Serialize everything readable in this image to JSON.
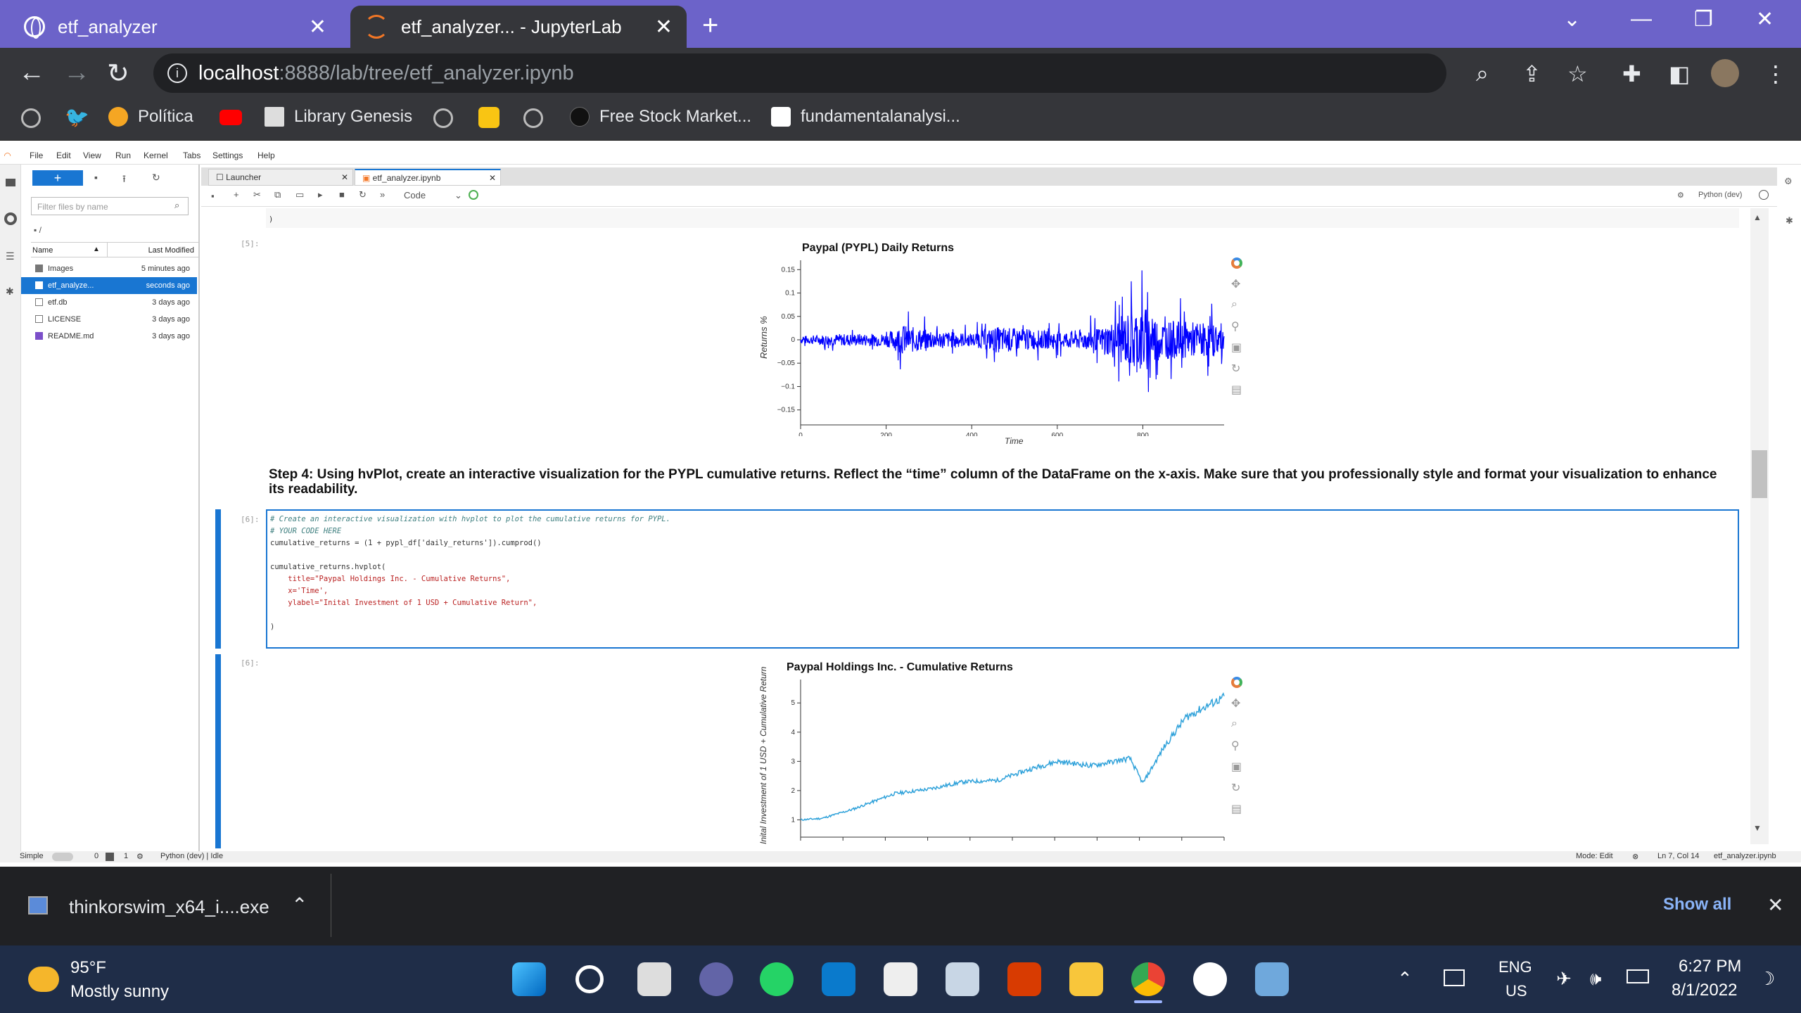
{
  "browser": {
    "tabs": [
      {
        "title": "etf_analyzer",
        "active": false
      },
      {
        "title": "etf_analyzer... - JupyterLab",
        "active": true
      }
    ],
    "url_host": "localhost",
    "url_path": ":8888/lab/tree/etf_analyzer.ipynb",
    "bookmarks": [
      "Política",
      "Library Genesis",
      "Free Stock Market...",
      "fundamentalanalysi..."
    ]
  },
  "jupyter": {
    "menu": [
      "File",
      "Edit",
      "View",
      "Run",
      "Kernel",
      "Tabs",
      "Settings",
      "Help"
    ],
    "filter_placeholder": "Filter files by name",
    "breadcrumb": "/",
    "file_columns": {
      "name": "Name",
      "modified": "Last Modified"
    },
    "files": [
      {
        "name": "Images",
        "modified": "5 minutes ago"
      },
      {
        "name": "etf_analyze...",
        "modified": "seconds ago"
      },
      {
        "name": "etf.db",
        "modified": "3 days ago"
      },
      {
        "name": "LICENSE",
        "modified": "3 days ago"
      },
      {
        "name": "README.md",
        "modified": "3 days ago"
      }
    ],
    "dock_tabs": [
      "Launcher",
      "etf_analyzer.ipynb"
    ],
    "cell_type": "Code",
    "kernel": "Python (dev)",
    "prompt_5": "[5]:",
    "prompt_6": "[6]:",
    "prompt_6_out": "[6]:",
    "closing_paren": ")",
    "markdown_text": "Step 4: Using hvPlot, create an interactive visualization for the PYPL cumulative returns. Reflect the “time” column of the DataFrame on the x-axis. Make sure that you professionally style and format your visualization to enhance its readability.",
    "code_lines": {
      "c1": "# Create an interactive visualization with hvplot to plot the cumulative returns for PYPL.",
      "c2": "# YOUR CODE HERE",
      "l3": "cumulative_returns = (1 + pypl_df['daily_returns']).cumprod()",
      "l5": "cumulative_returns.hvplot(",
      "l6": "    title=\"Paypal Holdings Inc. - Cumulative Returns\",",
      "l7": "    x='Time',",
      "l8": "    ylabel=\"Inital Investment of 1 USD + Cumulative Return\",",
      "l9": ")"
    },
    "status": {
      "mode_label": "Simple",
      "counts": "0",
      "count2": "1",
      "kernel_status": "Python (dev) | Idle",
      "mode": "Mode: Edit",
      "position": "Ln 7, Col 14",
      "file": "etf_analyzer.ipynb"
    }
  },
  "chart_data": [
    {
      "type": "line",
      "title": "Paypal (PYPL) Daily Returns",
      "xlabel": "Time",
      "ylabel": "Returns %",
      "x_ticks": [
        0,
        200,
        400,
        600,
        800
      ],
      "y_ticks": [
        0.15,
        0.1,
        0.05,
        0,
        -0.05,
        -0.1,
        -0.15
      ],
      "y_tick_labels": [
        "0.15",
        "0.1",
        "0.05",
        "0",
        "−0.05",
        "−0.1",
        "−0.15"
      ],
      "xlim": [
        0,
        990
      ],
      "ylim": [
        -0.17,
        0.17
      ],
      "color": "#0000ff",
      "volatility_profile": [
        {
          "x": 0,
          "amp": 0.012
        },
        {
          "x": 80,
          "amp": 0.018
        },
        {
          "x": 200,
          "amp": 0.02
        },
        {
          "x": 240,
          "amp": 0.045
        },
        {
          "x": 300,
          "amp": 0.03
        },
        {
          "x": 400,
          "amp": 0.02
        },
        {
          "x": 460,
          "amp": 0.04
        },
        {
          "x": 600,
          "amp": 0.025
        },
        {
          "x": 700,
          "amp": 0.035
        },
        {
          "x": 800,
          "amp": 0.11
        },
        {
          "x": 840,
          "amp": 0.06
        },
        {
          "x": 990,
          "amp": 0.05
        }
      ]
    },
    {
      "type": "line",
      "title": "Paypal Holdings Inc. - Cumulative Returns",
      "ylabel": "Inital Investment of 1 USD + Cumulative Return",
      "y_ticks": [
        1,
        2,
        3,
        4,
        5
      ],
      "ylim": [
        0.6,
        5.8
      ],
      "color": "#30a2da",
      "keypoints": [
        {
          "x": 0,
          "y": 1.0
        },
        {
          "x": 50,
          "y": 1.05
        },
        {
          "x": 120,
          "y": 1.35
        },
        {
          "x": 220,
          "y": 1.9
        },
        {
          "x": 300,
          "y": 2.05
        },
        {
          "x": 380,
          "y": 2.3
        },
        {
          "x": 460,
          "y": 2.35
        },
        {
          "x": 540,
          "y": 2.75
        },
        {
          "x": 600,
          "y": 3.0
        },
        {
          "x": 680,
          "y": 2.85
        },
        {
          "x": 770,
          "y": 3.1
        },
        {
          "x": 800,
          "y": 2.25
        },
        {
          "x": 850,
          "y": 3.5
        },
        {
          "x": 900,
          "y": 4.5
        },
        {
          "x": 950,
          "y": 4.9
        },
        {
          "x": 990,
          "y": 5.2
        }
      ]
    }
  ],
  "downloads": {
    "file": "thinkorswim_x64_i....exe",
    "show_all": "Show all"
  },
  "taskbar": {
    "weather_temp": "95°F",
    "weather_desc": "Mostly sunny",
    "lang1": "ENG",
    "lang2": "US",
    "time": "6:27 PM",
    "date": "8/1/2022"
  }
}
